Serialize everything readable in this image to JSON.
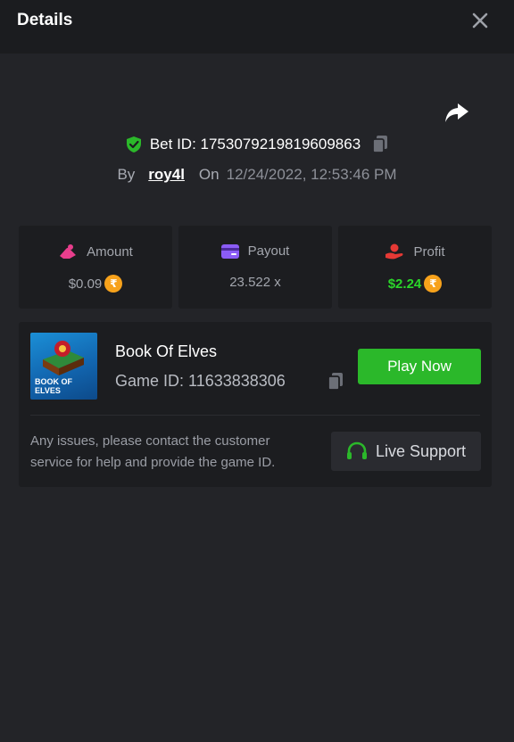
{
  "header": {
    "title": "Details"
  },
  "bet": {
    "id_label": "Bet ID: 1753079219819609863",
    "by_label": "By",
    "user": "roy4l",
    "on_label": "On",
    "datetime": "12/24/2022, 12:53:46 PM"
  },
  "stats": {
    "amount": {
      "label": "Amount",
      "value": "$0.09"
    },
    "payout": {
      "label": "Payout",
      "value": "23.522 x"
    },
    "profit": {
      "label": "Profit",
      "value": "$2.24"
    }
  },
  "currency_symbol": "₹",
  "game": {
    "thumb_text": "BOOK OF ELVES",
    "name": "Book Of Elves",
    "id_label": "Game ID: 11633838306",
    "play_label": "Play Now"
  },
  "support": {
    "help_text": "Any issues, please contact the customer service for help and provide the game ID.",
    "button_label": "Live Support"
  },
  "colors": {
    "accent_green": "#2bb82a",
    "profit_green": "#2bd62a",
    "amount_pink": "#e83e8c",
    "payout_purple": "#8b5cf6",
    "profit_red": "#e53935",
    "coin_orange": "#f7a21b",
    "background": "#232428",
    "card": "#1c1d20"
  },
  "icons": {
    "close": "close-icon",
    "share": "share-icon",
    "verified": "shield-check-icon",
    "copy": "copy-icon",
    "amount": "amount-icon",
    "payout": "payout-card-icon",
    "profit": "profit-hand-icon",
    "headset": "headset-icon"
  }
}
